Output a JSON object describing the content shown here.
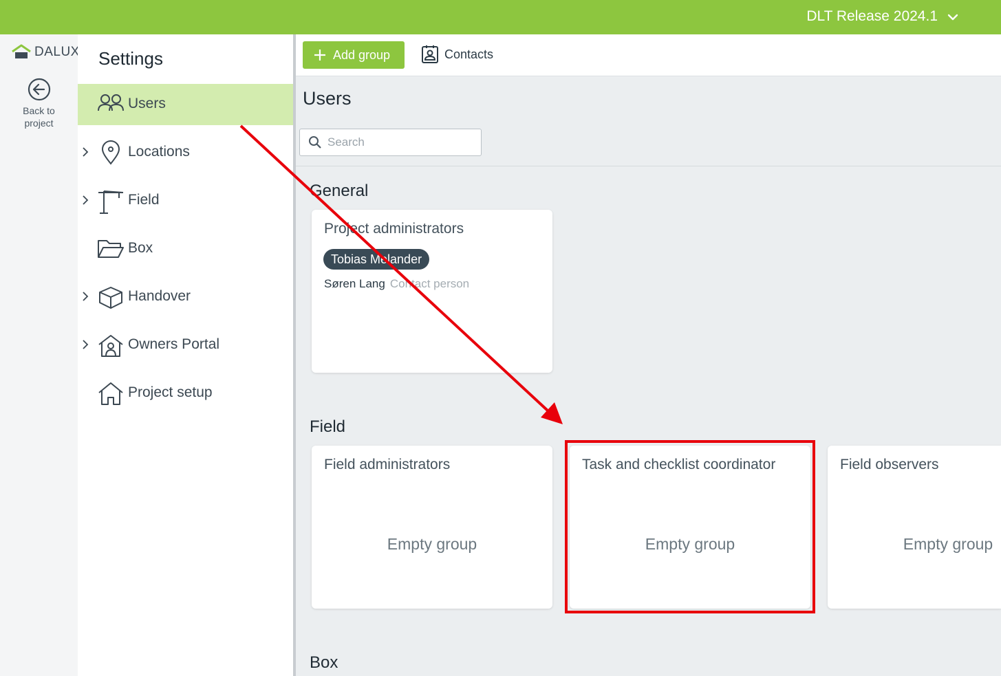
{
  "topbar": {
    "project_name": "DLT Release 2024.1"
  },
  "rail": {
    "logo_text": "DALUX",
    "back_line1": "Back to",
    "back_line2": "project"
  },
  "settings": {
    "title": "Settings",
    "items": [
      {
        "label": "Users",
        "active": true,
        "expandable": false
      },
      {
        "label": "Locations",
        "active": false,
        "expandable": true
      },
      {
        "label": "Field",
        "active": false,
        "expandable": true
      },
      {
        "label": "Box",
        "active": false,
        "expandable": false
      },
      {
        "label": "Handover",
        "active": false,
        "expandable": true
      },
      {
        "label": "Owners Portal",
        "active": false,
        "expandable": true
      },
      {
        "label": "Project setup",
        "active": false,
        "expandable": false
      }
    ]
  },
  "toolbar": {
    "add_group_label": "Add group",
    "contacts_label": "Contacts"
  },
  "main": {
    "title": "Users",
    "search_placeholder": "Search",
    "sections": {
      "general": {
        "title": "General",
        "groups": [
          {
            "title": "Project administrators",
            "chip_member": "Tobias Melander",
            "member": "Søren Lang",
            "member_role": "Contact person"
          }
        ]
      },
      "field": {
        "title": "Field",
        "groups": [
          {
            "title": "Field administrators",
            "empty_text": "Empty group"
          },
          {
            "title": "Task and checklist coordinator",
            "empty_text": "Empty group"
          },
          {
            "title": "Field observers",
            "empty_text": "Empty group"
          }
        ]
      },
      "box": {
        "title": "Box"
      }
    }
  },
  "colors": {
    "brand_green": "#8dc63f",
    "active_nav": "#d3ecaf",
    "annotation_red": "#e8000b"
  }
}
